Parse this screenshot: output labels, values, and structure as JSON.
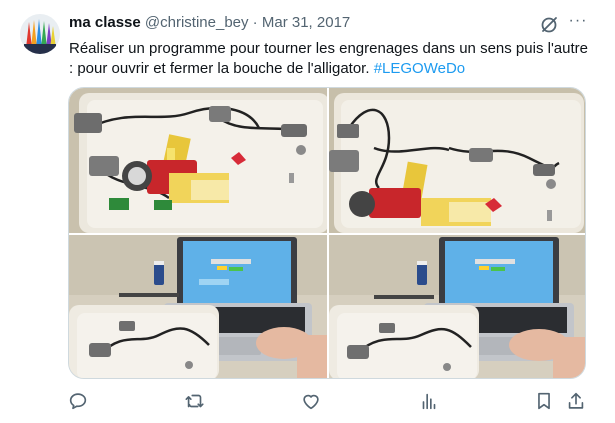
{
  "tweet": {
    "author_name": "ma classe",
    "author_handle": "@christine_bey",
    "separator": " · ",
    "date": "Mar 31, 2017",
    "more_label": "···",
    "text_main": "Réaliser un programme pour tourner les engrenages dans un sens puis l'autre : pour ouvrir et fermer la bouche de l'alligator. ",
    "hashtag": "#LEGOWeDo"
  },
  "media": {
    "photos": [
      "lego-model-top-left",
      "lego-model-top-right",
      "laptop-bottom-left",
      "laptop-bottom-right"
    ]
  },
  "actions": {
    "items": [
      "reply-icon",
      "retweet-icon",
      "like-icon",
      "views-icon",
      "bookmark-icon",
      "share-icon"
    ]
  },
  "colors": {
    "text": "#0f1419",
    "secondary": "#536471",
    "link": "#1d9bf0",
    "border": "#cfd9de"
  }
}
